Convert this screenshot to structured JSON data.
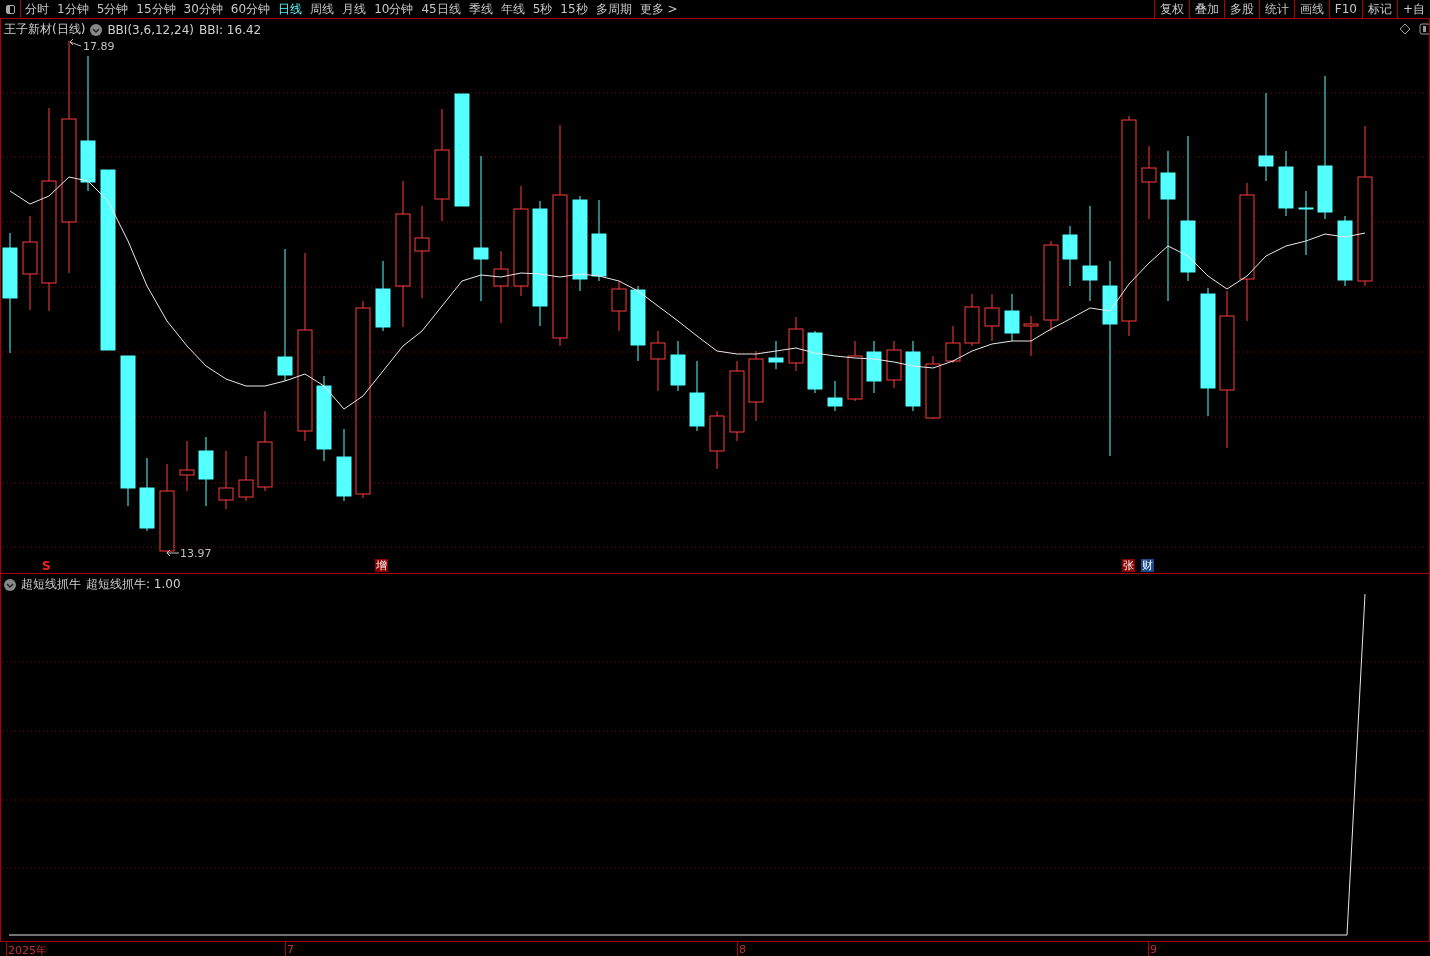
{
  "toolbar": {
    "periods": [
      {
        "label": "分时",
        "selected": false
      },
      {
        "label": "1分钟",
        "selected": false
      },
      {
        "label": "5分钟",
        "selected": false
      },
      {
        "label": "15分钟",
        "selected": false
      },
      {
        "label": "30分钟",
        "selected": false
      },
      {
        "label": "60分钟",
        "selected": false
      },
      {
        "label": "日线",
        "selected": true
      },
      {
        "label": "周线",
        "selected": false
      },
      {
        "label": "月线",
        "selected": false
      },
      {
        "label": "10分钟",
        "selected": false
      },
      {
        "label": "45日线",
        "selected": false
      },
      {
        "label": "季线",
        "selected": false
      },
      {
        "label": "年线",
        "selected": false
      },
      {
        "label": "5秒",
        "selected": false
      },
      {
        "label": "15秒",
        "selected": false
      },
      {
        "label": "多周期",
        "selected": false
      }
    ],
    "more": "更多 >",
    "tools": [
      "复权",
      "叠加",
      "多股",
      "统计",
      "画线",
      "F10",
      "标记",
      "+自"
    ]
  },
  "price_panel": {
    "title": "王子新材(日线)",
    "indicator": "BBI(3,6,12,24)",
    "reading": "BBI: 16.42",
    "high_label": "17.89",
    "low_label": "13.97",
    "signals": [
      {
        "label": "S",
        "color": "#ff2020"
      },
      {
        "label": "增",
        "color": "#8b0000"
      },
      {
        "label": "张",
        "color": "#8b0000"
      },
      {
        "label": "财",
        "color": "#1a4a8a"
      }
    ]
  },
  "indicator_panel": {
    "name": "超短线抓牛",
    "reading": "超短线抓牛: 1.00"
  },
  "x_axis": {
    "labels": [
      "2025年",
      "7",
      "8",
      "9"
    ]
  }
}
